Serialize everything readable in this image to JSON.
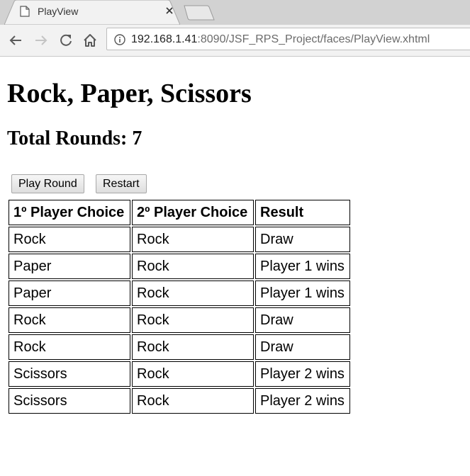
{
  "browser": {
    "tab": {
      "title": "PlayView"
    },
    "address": {
      "host": "192.168.1.41",
      "rest": ":8090/JSF_RPS_Project/faces/PlayView.xhtml"
    }
  },
  "page": {
    "title": "Rock, Paper, Scissors",
    "rounds_label": "Total Rounds: 7",
    "buttons": {
      "play": "Play Round",
      "restart": "Restart"
    },
    "table": {
      "headers": [
        "1º Player Choice",
        "2º Player Choice",
        "Result"
      ],
      "rows": [
        [
          "Rock",
          "Rock",
          "Draw"
        ],
        [
          "Paper",
          "Rock",
          "Player 1 wins"
        ],
        [
          "Paper",
          "Rock",
          "Player 1 wins"
        ],
        [
          "Rock",
          "Rock",
          "Draw"
        ],
        [
          "Rock",
          "Rock",
          "Draw"
        ],
        [
          "Scissors",
          "Rock",
          "Player 2 wins"
        ],
        [
          "Scissors",
          "Rock",
          "Player 2 wins"
        ]
      ]
    }
  }
}
